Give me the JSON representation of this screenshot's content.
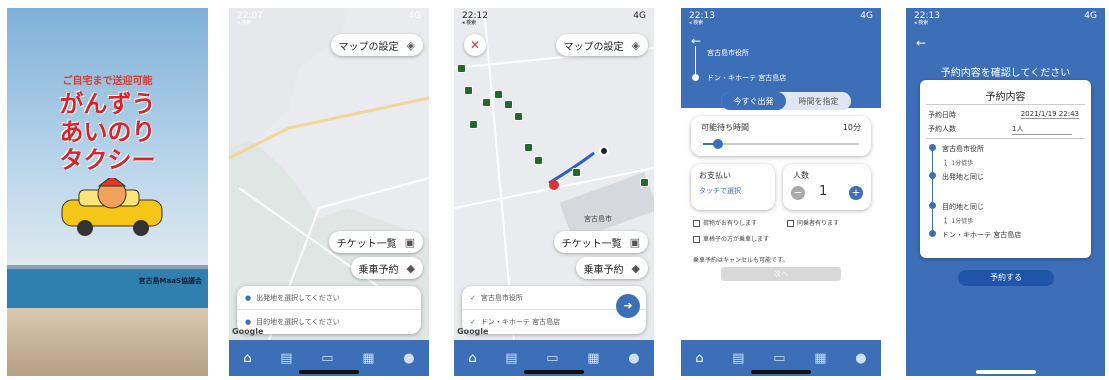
{
  "screens": {
    "splash": {
      "headline_small": "ご自宅まで送迎可能",
      "title_lines": [
        "がんずう",
        "あいのり",
        "タクシー"
      ],
      "org": "宮古島MaaS協議会"
    },
    "map1": {
      "time": "22:07",
      "sub": "◂ 検索",
      "signal": "4G",
      "map_settings": "マップの設定",
      "ticket_list": "チケット一覧",
      "ride_reserve": "乗車予約",
      "origin_placeholder": "出発地を選択してください",
      "dest_placeholder": "目的地を選択してください",
      "google": "Google"
    },
    "map2": {
      "time": "22:12",
      "sub": "◂ 検索",
      "signal": "4G",
      "map_settings": "マップの設定",
      "ticket_list": "チケット一覧",
      "ride_reserve": "乗車予約",
      "city_label": "宮古島市",
      "origin": "宮古島市役所",
      "dest": "ドン・キホーテ 宮古島店",
      "google": "Google"
    },
    "booking": {
      "time": "22:13",
      "sub": "◂ 検索",
      "signal": "4G",
      "origin": "宮古島市役所",
      "dest": "ドン・キホーテ 宮古島店",
      "tab_now": "今すぐ出発",
      "tab_schedule": "時間を指定",
      "wait_label": "可能待ち時間",
      "wait_value": "10分",
      "payment_label": "お支払い",
      "payment_value": "タッチで選択",
      "pax_label": "人数",
      "pax_value": "1",
      "check1": "荷物がお有りします",
      "check2": "同乗者有ります",
      "check3": "車椅子の方が乗車します",
      "note": "乗車予約はキャンセルも可能です。",
      "next": "次へ"
    },
    "confirm": {
      "time": "22:13",
      "sub": "◂ 検索",
      "signal": "4G",
      "heading": "予約内容を確認してください",
      "card_title": "予約内容",
      "date_label": "予約日時",
      "date_value": "2021/1/19 22:43",
      "pax_label": "予約人数",
      "pax_value": "1人",
      "stop1": "宮古島市役所",
      "walk1": "1分徒歩",
      "stop2": "出発地と同じ",
      "stop3": "目的地と同じ",
      "walk2": "1分徒歩",
      "stop4": "ドン・キホーテ 宮古島店",
      "button": "予約する"
    }
  },
  "colors": {
    "brand_blue": "#3c6fb8",
    "title_red": "#d8232a",
    "tagline_red": "#e03a2a"
  }
}
